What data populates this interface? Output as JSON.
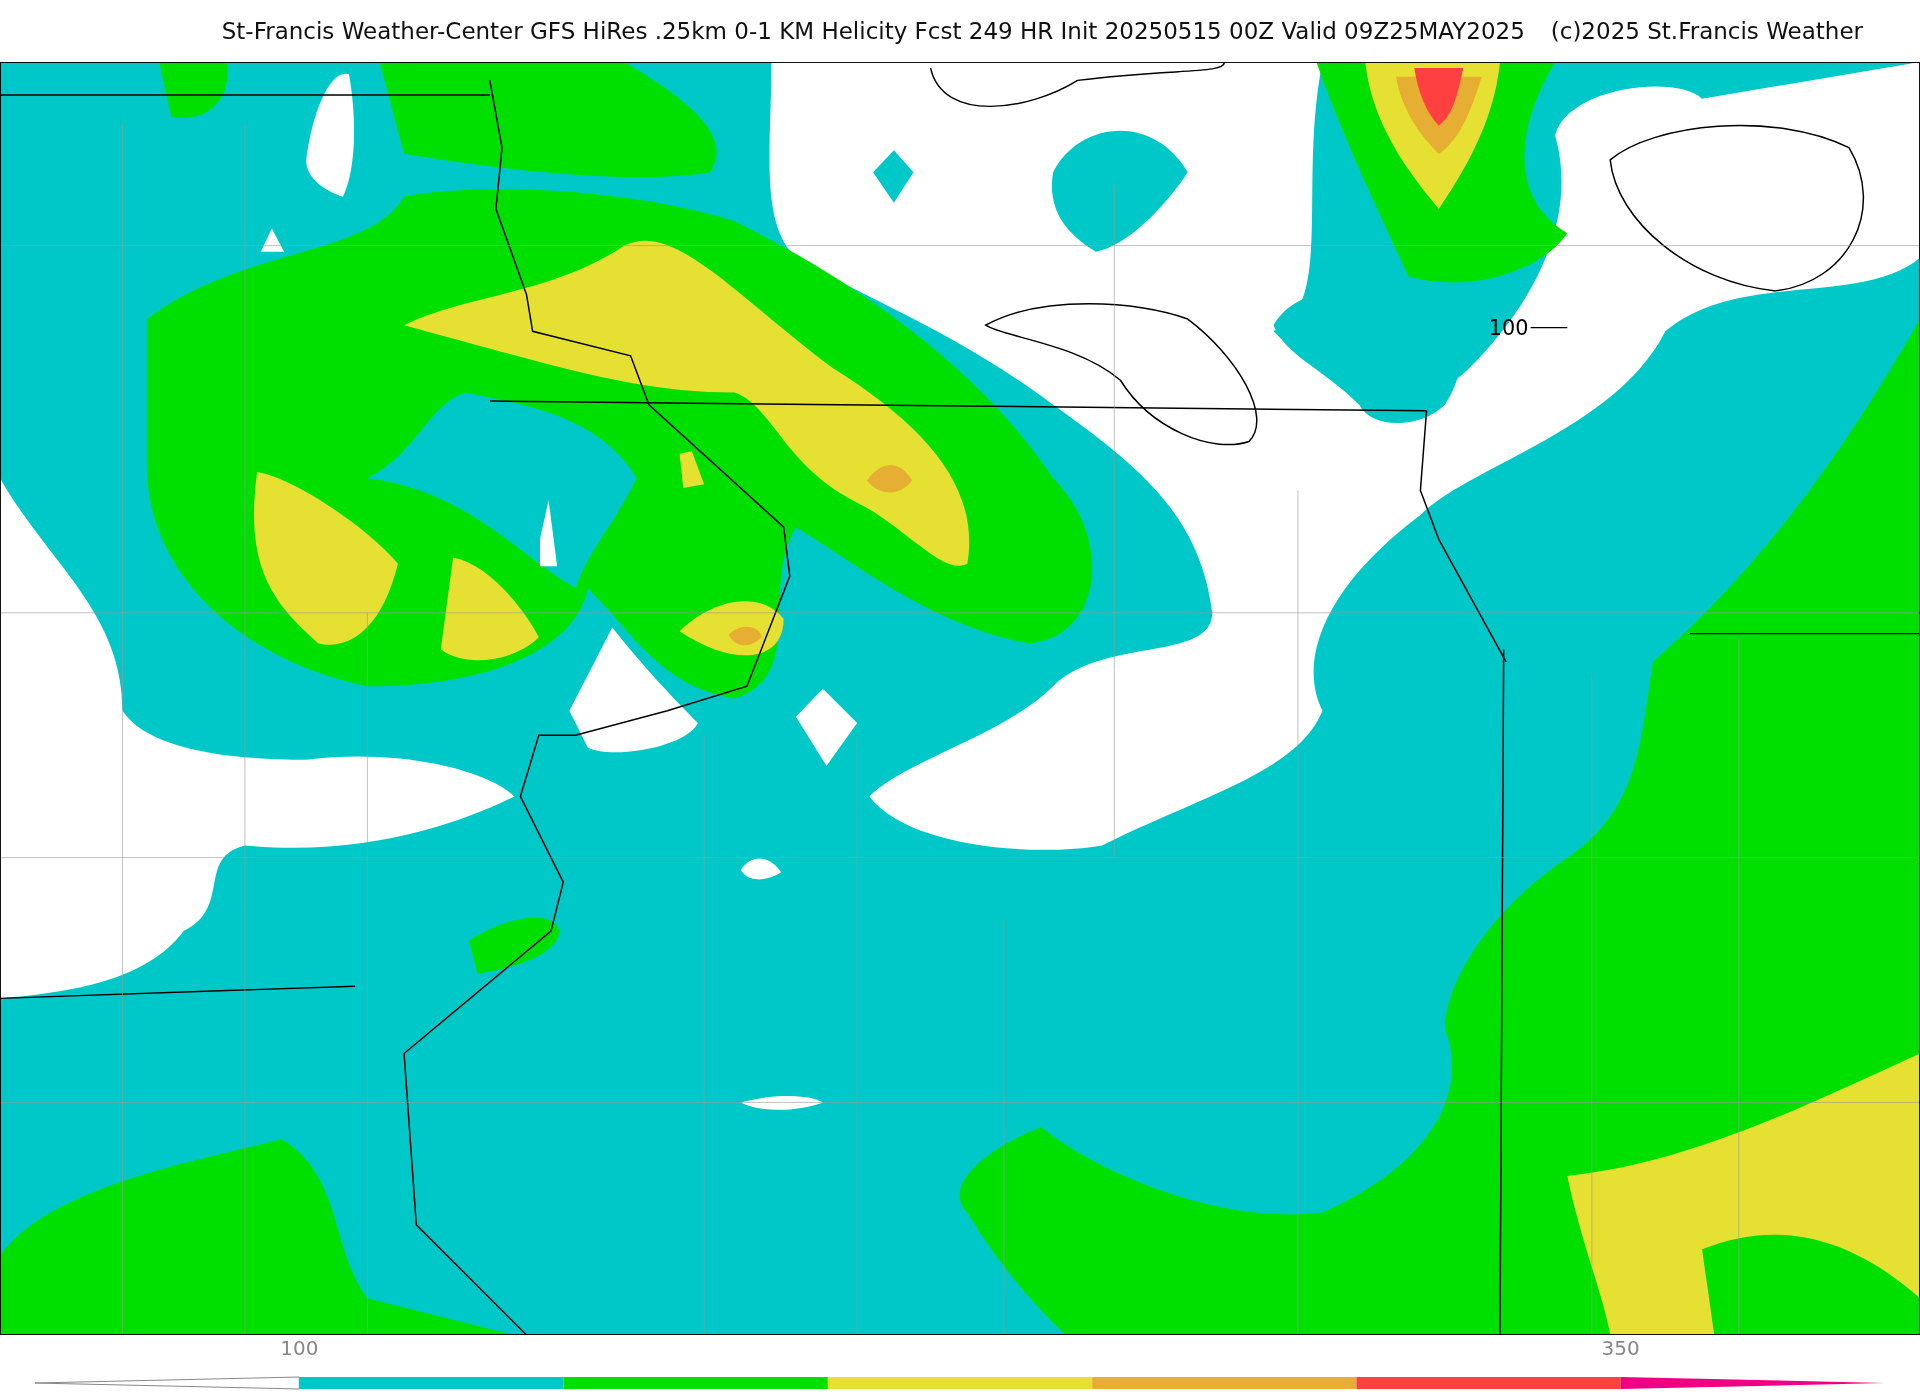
{
  "header": {
    "title": "St-Francis Weather-Center GFS HiRes .25km 0-1 KM Helicity Fcst 249 HR Init 20250515 00Z  Valid 09Z25MAY2025",
    "credit": "(c)2025 St.Francis Weather"
  },
  "map": {
    "contour_label": "100"
  },
  "colorbar": {
    "labels": [
      "100",
      "350"
    ],
    "segments": [
      {
        "kind": "arrow",
        "color": "#ffffff"
      },
      {
        "kind": "bar",
        "color": "#00c8c8"
      },
      {
        "kind": "bar",
        "color": "#00e000"
      },
      {
        "kind": "bar",
        "color": "#e6e032"
      },
      {
        "kind": "bar",
        "color": "#e6ae32"
      },
      {
        "kind": "bar",
        "color": "#ff4040"
      },
      {
        "kind": "arrow",
        "color": "#f00082"
      }
    ]
  }
}
